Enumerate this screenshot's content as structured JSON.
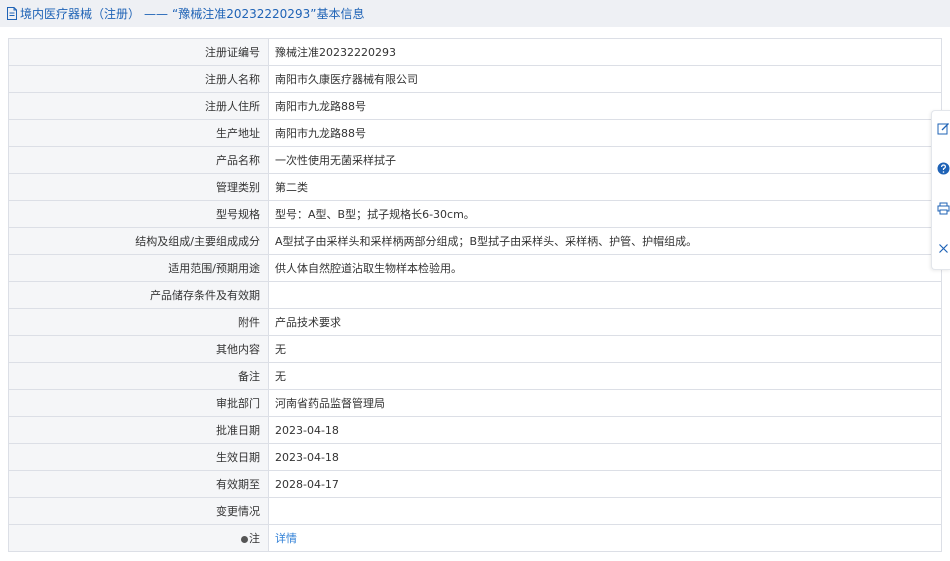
{
  "header": {
    "icon": "document-icon",
    "section": "境内医疗器械（注册）",
    "separator": "——",
    "reg_quoted": "“豫械注准20232220293”",
    "tail": "基本信息"
  },
  "rows": [
    {
      "label": "注册证编号",
      "value": "豫械注准20232220293"
    },
    {
      "label": "注册人名称",
      "value": "南阳市久康医疗器械有限公司"
    },
    {
      "label": "注册人住所",
      "value": "南阳市九龙路88号"
    },
    {
      "label": "生产地址",
      "value": "南阳市九龙路88号"
    },
    {
      "label": "产品名称",
      "value": "一次性使用无菌采样拭子"
    },
    {
      "label": "管理类别",
      "value": "第二类"
    },
    {
      "label": "型号规格",
      "value": "型号：A型、B型；拭子规格长6-30cm。"
    },
    {
      "label": "结构及组成/主要组成成分",
      "value": "A型拭子由采样头和采样柄两部分组成；B型拭子由采样头、采样柄、护管、护帽组成。"
    },
    {
      "label": "适用范围/预期用途",
      "value": "供人体自然腔道沾取生物样本检验用。"
    },
    {
      "label": "产品储存条件及有效期",
      "value": ""
    },
    {
      "label": "附件",
      "value": "产品技术要求"
    },
    {
      "label": "其他内容",
      "value": "无"
    },
    {
      "label": "备注",
      "value": "无"
    },
    {
      "label": "审批部门",
      "value": "河南省药品监督管理局"
    },
    {
      "label": "批准日期",
      "value": "2023-04-18"
    },
    {
      "label": "生效日期",
      "value": "2023-04-18"
    },
    {
      "label": "有效期至",
      "value": "2028-04-17"
    },
    {
      "label": "变更情况",
      "value": ""
    }
  ],
  "note_row": {
    "label": "注",
    "link": "详情"
  },
  "side_tools": [
    "edit-icon",
    "help-icon",
    "print-icon",
    "close-icon"
  ],
  "colors": {
    "accent": "#1f63b6",
    "link": "#2f7fd6",
    "label_bg": "#f5f6f8",
    "border": "#dcdfe6"
  }
}
